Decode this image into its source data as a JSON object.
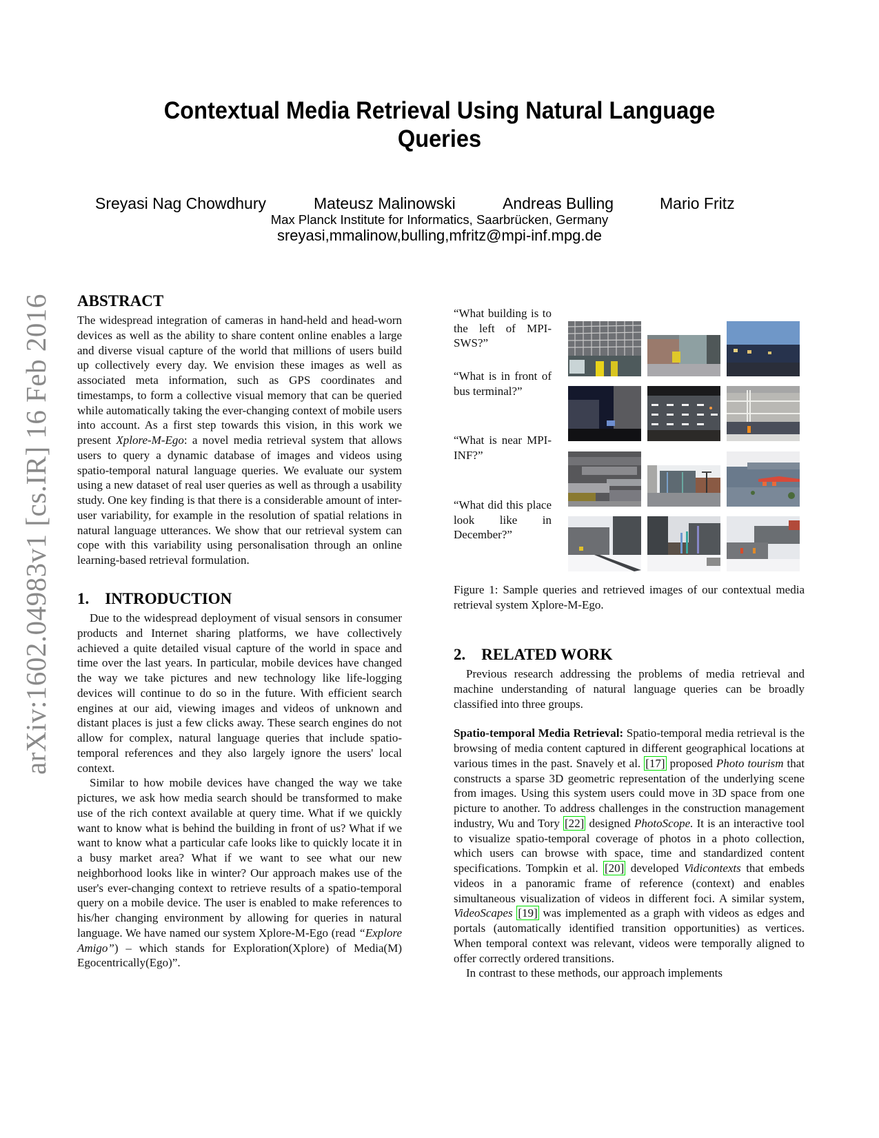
{
  "arxiv_stamp": "arXiv:1602.04983v1  [cs.IR]  16 Feb 2016",
  "paper": {
    "title_line1": "Contextual Media Retrieval Using Natural Language",
    "title_line2": "Queries",
    "authors": [
      "Sreyasi Nag Chowdhury",
      "Mateusz Malinowski",
      "Andreas Bulling",
      "Mario Fritz"
    ],
    "affiliation": "Max Planck Institute for Informatics, Saarbrücken, Germany",
    "email": "sreyasi,mmalinow,bulling,mfritz@mpi-inf.mpg.de"
  },
  "abstract": {
    "heading": "ABSTRACT",
    "text_before_italic": "The widespread integration of cameras in hand-held and head-worn devices as well as the ability to share content online enables a large and diverse visual capture of the world that millions of users build up collectively every day. We envision these images as well as associated meta information, such as GPS coordinates and timestamps, to form a collective visual memory that can be queried while automatically taking the ever-changing context of mobile users into account. As a first step towards this vision, in this work we present ",
    "italic": "Xplore-M-Ego",
    "text_after_italic": ": a novel media retrieval system that allows users to query a dynamic database of images and videos using spatio-temporal natural language queries. We evaluate our system using a new dataset of real user queries as well as through a usability study. One key finding is that there is a considerable amount of inter-user variability, for example in the resolution of spatial relations in natural language utterances. We show that our retrieval system can cope with this variability using personalisation through an online learning-based retrieval formulation."
  },
  "introduction": {
    "heading": "1.    INTRODUCTION",
    "para1": "Due to the widespread deployment of visual sensors in consumer products and Internet sharing platforms, we have collectively achieved a quite detailed visual capture of the world in space and time over the last years. In particular, mobile devices have changed the way we take pictures and new technology like life-logging devices will continue to do so in the future. With efficient search engines at our aid, viewing images and videos of unknown and distant places is just a few clicks away. These search engines do not allow for complex, natural language queries that include spatio-temporal references and they also largely ignore the users' local context.",
    "para2_before_italic": "Similar to how mobile devices have changed the way we take pictures, we ask how media search should be transformed to make use of the rich context available at query time. What if we quickly want to know what is behind the building in front of us? What if we want to know what a particular cafe looks like to quickly locate it in a busy market area? What if we want to see what our new neighborhood looks like in winter? Our approach makes use of the user's ever-changing context to retrieve results of a spatio-temporal query on a mobile device. The user is enabled to make references to his/her changing environment by allowing for queries in natural language. We have named our system Xplore-M-Ego (read ",
    "para2_italic": "“Explore Amigo”",
    "para2_after_italic": ") – which stands for Exploration(Xplore) of Media(M) Egocentrically(Ego)”."
  },
  "figure1": {
    "queries": [
      "“What building is to the left of MPI-SWS?”",
      "“What is in front of bus terminal?”",
      "“What is near MPI-INF?”",
      "“What did this place look like in December?”"
    ],
    "image_rows": [
      [
        "building-facade-yellow-doors",
        "glass-entrance-plaza",
        "dusk-buildings-blue-sky"
      ],
      [
        "night-building-corner",
        "night-parking-garage-lights",
        "bus-terminal-structure"
      ],
      [
        "modern-facade-panels",
        "office-building-flags-lamp",
        "cafe-red-umbrella"
      ],
      [
        "winter-snow-buildings",
        "winter-flags-building",
        "winter-snow-round-building"
      ]
    ],
    "caption": "Figure 1: Sample queries and retrieved images of our contextual media retrieval system Xplore-M-Ego."
  },
  "related_work": {
    "heading": "2.    RELATED WORK",
    "intro": "Previous research addressing the problems of media retrieval and machine understanding of natural language queries can be broadly classified into three groups.",
    "subsection_label": "Spatio-temporal Media Retrieval:",
    "seg1": " Spatio-temporal media retrieval is the browsing of media content captured in different geographical locations at various times in the past. Snavely et al. ",
    "cite17": "[17]",
    "seg2": " proposed ",
    "italic_photo_tourism": "Photo tourism",
    "seg3": " that constructs a sparse 3D geometric representation of the underlying scene from images. Using this system users could move in 3D space from one picture to another. To address challenges in the construction management industry, Wu and Tory ",
    "cite22": "[22]",
    "seg4": " designed ",
    "italic_photoscope": "PhotoScope.",
    "seg5": " It is an interactive tool to visualize spatio-temporal coverage of photos in a photo collection, which users can browse with space, time and standardized content specifications. Tompkin et al. ",
    "cite20": "[20]",
    "seg6": " developed ",
    "italic_vidicontexts": "Vidicontexts",
    "seg7": " that embeds videos in a panoramic frame of reference (context) and enables simultaneous visualization of videos in different foci. A similar system, ",
    "italic_videoscapes": "VideoScapes",
    "seg8": " ",
    "cite19": "[19]",
    "seg9": " was implemented as a graph with videos as edges and portals (automatically identified transition opportunities) as vertices. When temporal context was relevant, videos were temporally aligned to offer correctly ordered transitions.",
    "para_last": "In contrast to these methods, our approach implements"
  }
}
